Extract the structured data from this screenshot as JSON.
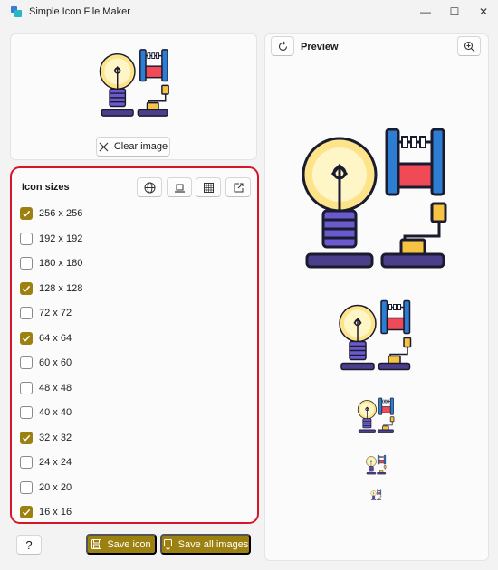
{
  "window": {
    "title": "Simple Icon File Maker",
    "minimize_glyph": "—",
    "maximize_glyph": "☐",
    "close_glyph": "✕"
  },
  "image_panel": {
    "clear_label": "Clear image"
  },
  "sizes": {
    "title": "Icon sizes",
    "items": [
      {
        "label": "256 x 256",
        "checked": true
      },
      {
        "label": "192 x 192",
        "checked": false
      },
      {
        "label": "180 x 180",
        "checked": false
      },
      {
        "label": "128 x 128",
        "checked": true
      },
      {
        "label": "72 x 72",
        "checked": false
      },
      {
        "label": "64 x 64",
        "checked": true
      },
      {
        "label": "60 x 60",
        "checked": false
      },
      {
        "label": "48 x 48",
        "checked": false
      },
      {
        "label": "40 x 40",
        "checked": false
      },
      {
        "label": "32 x 32",
        "checked": true
      },
      {
        "label": "24 x 24",
        "checked": false
      },
      {
        "label": "20 x 20",
        "checked": false
      },
      {
        "label": "16 x 16",
        "checked": true
      }
    ],
    "preset_icons": [
      "globe-icon",
      "laptop-icon",
      "windows-icon",
      "export-icon"
    ]
  },
  "footer": {
    "help_label": "?",
    "save_icon_label": "Save icon",
    "save_all_label": "Save all images"
  },
  "preview": {
    "title": "Preview"
  },
  "colors": {
    "accent": "#9c8010",
    "highlight_border": "#d7152a"
  }
}
